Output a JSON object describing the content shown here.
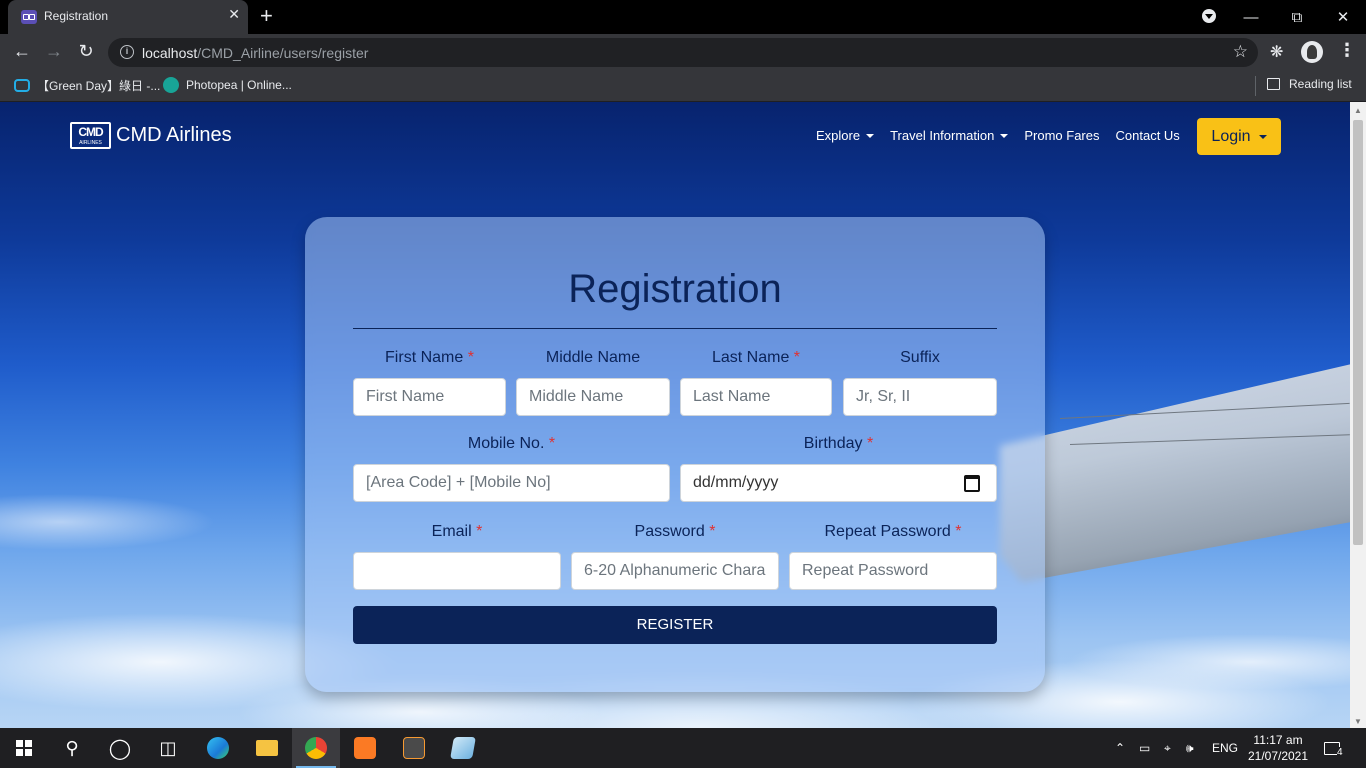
{
  "browser": {
    "tab_title": "Registration",
    "tab_close": "✕",
    "new_tab": "+",
    "url_host": "localhost",
    "url_path": "/CMD_Airline/users/register",
    "bookmarks": [
      {
        "label": "【Green Day】綠日 -..."
      },
      {
        "label": "Photopea | Online..."
      }
    ],
    "reading_list": "Reading list"
  },
  "navbar": {
    "brand_logo": "CMD",
    "brand_logo_sub": "AIRLINES",
    "brand_name": "CMD Airlines",
    "links": [
      {
        "label": "Explore",
        "dropdown": true
      },
      {
        "label": "Travel Information",
        "dropdown": true
      },
      {
        "label": "Promo Fares",
        "dropdown": false
      },
      {
        "label": "Contact Us",
        "dropdown": false
      }
    ],
    "login_label": "Login"
  },
  "form": {
    "title": "Registration",
    "required_mark": "*",
    "fields": {
      "first_name": {
        "label": "First Name",
        "placeholder": "First Name",
        "required": true
      },
      "middle_name": {
        "label": "Middle Name",
        "placeholder": "Middle Name",
        "required": false
      },
      "last_name": {
        "label": "Last Name",
        "placeholder": "Last Name",
        "required": true
      },
      "suffix": {
        "label": "Suffix",
        "placeholder": "Jr, Sr, II",
        "required": false
      },
      "mobile": {
        "label": "Mobile No.",
        "placeholder": "[Area Code] + [Mobile No]",
        "required": true
      },
      "birthday": {
        "label": "Birthday",
        "placeholder": "dd/mm/yyyy",
        "required": true
      },
      "email": {
        "label": "Email",
        "placeholder": "",
        "required": true
      },
      "password": {
        "label": "Password",
        "placeholder": "6-20 Alphanumeric Chara",
        "required": true
      },
      "repeat_password": {
        "label": "Repeat Password",
        "placeholder": "Repeat Password",
        "required": true
      }
    },
    "submit_label": "REGISTER"
  },
  "taskbar": {
    "language": "ENG",
    "time": "11:17 am",
    "date": "21/07/2021",
    "notification_count": "4"
  },
  "colors": {
    "primary": "#0b2358",
    "accent": "#f9c116",
    "required": "#e03131"
  }
}
